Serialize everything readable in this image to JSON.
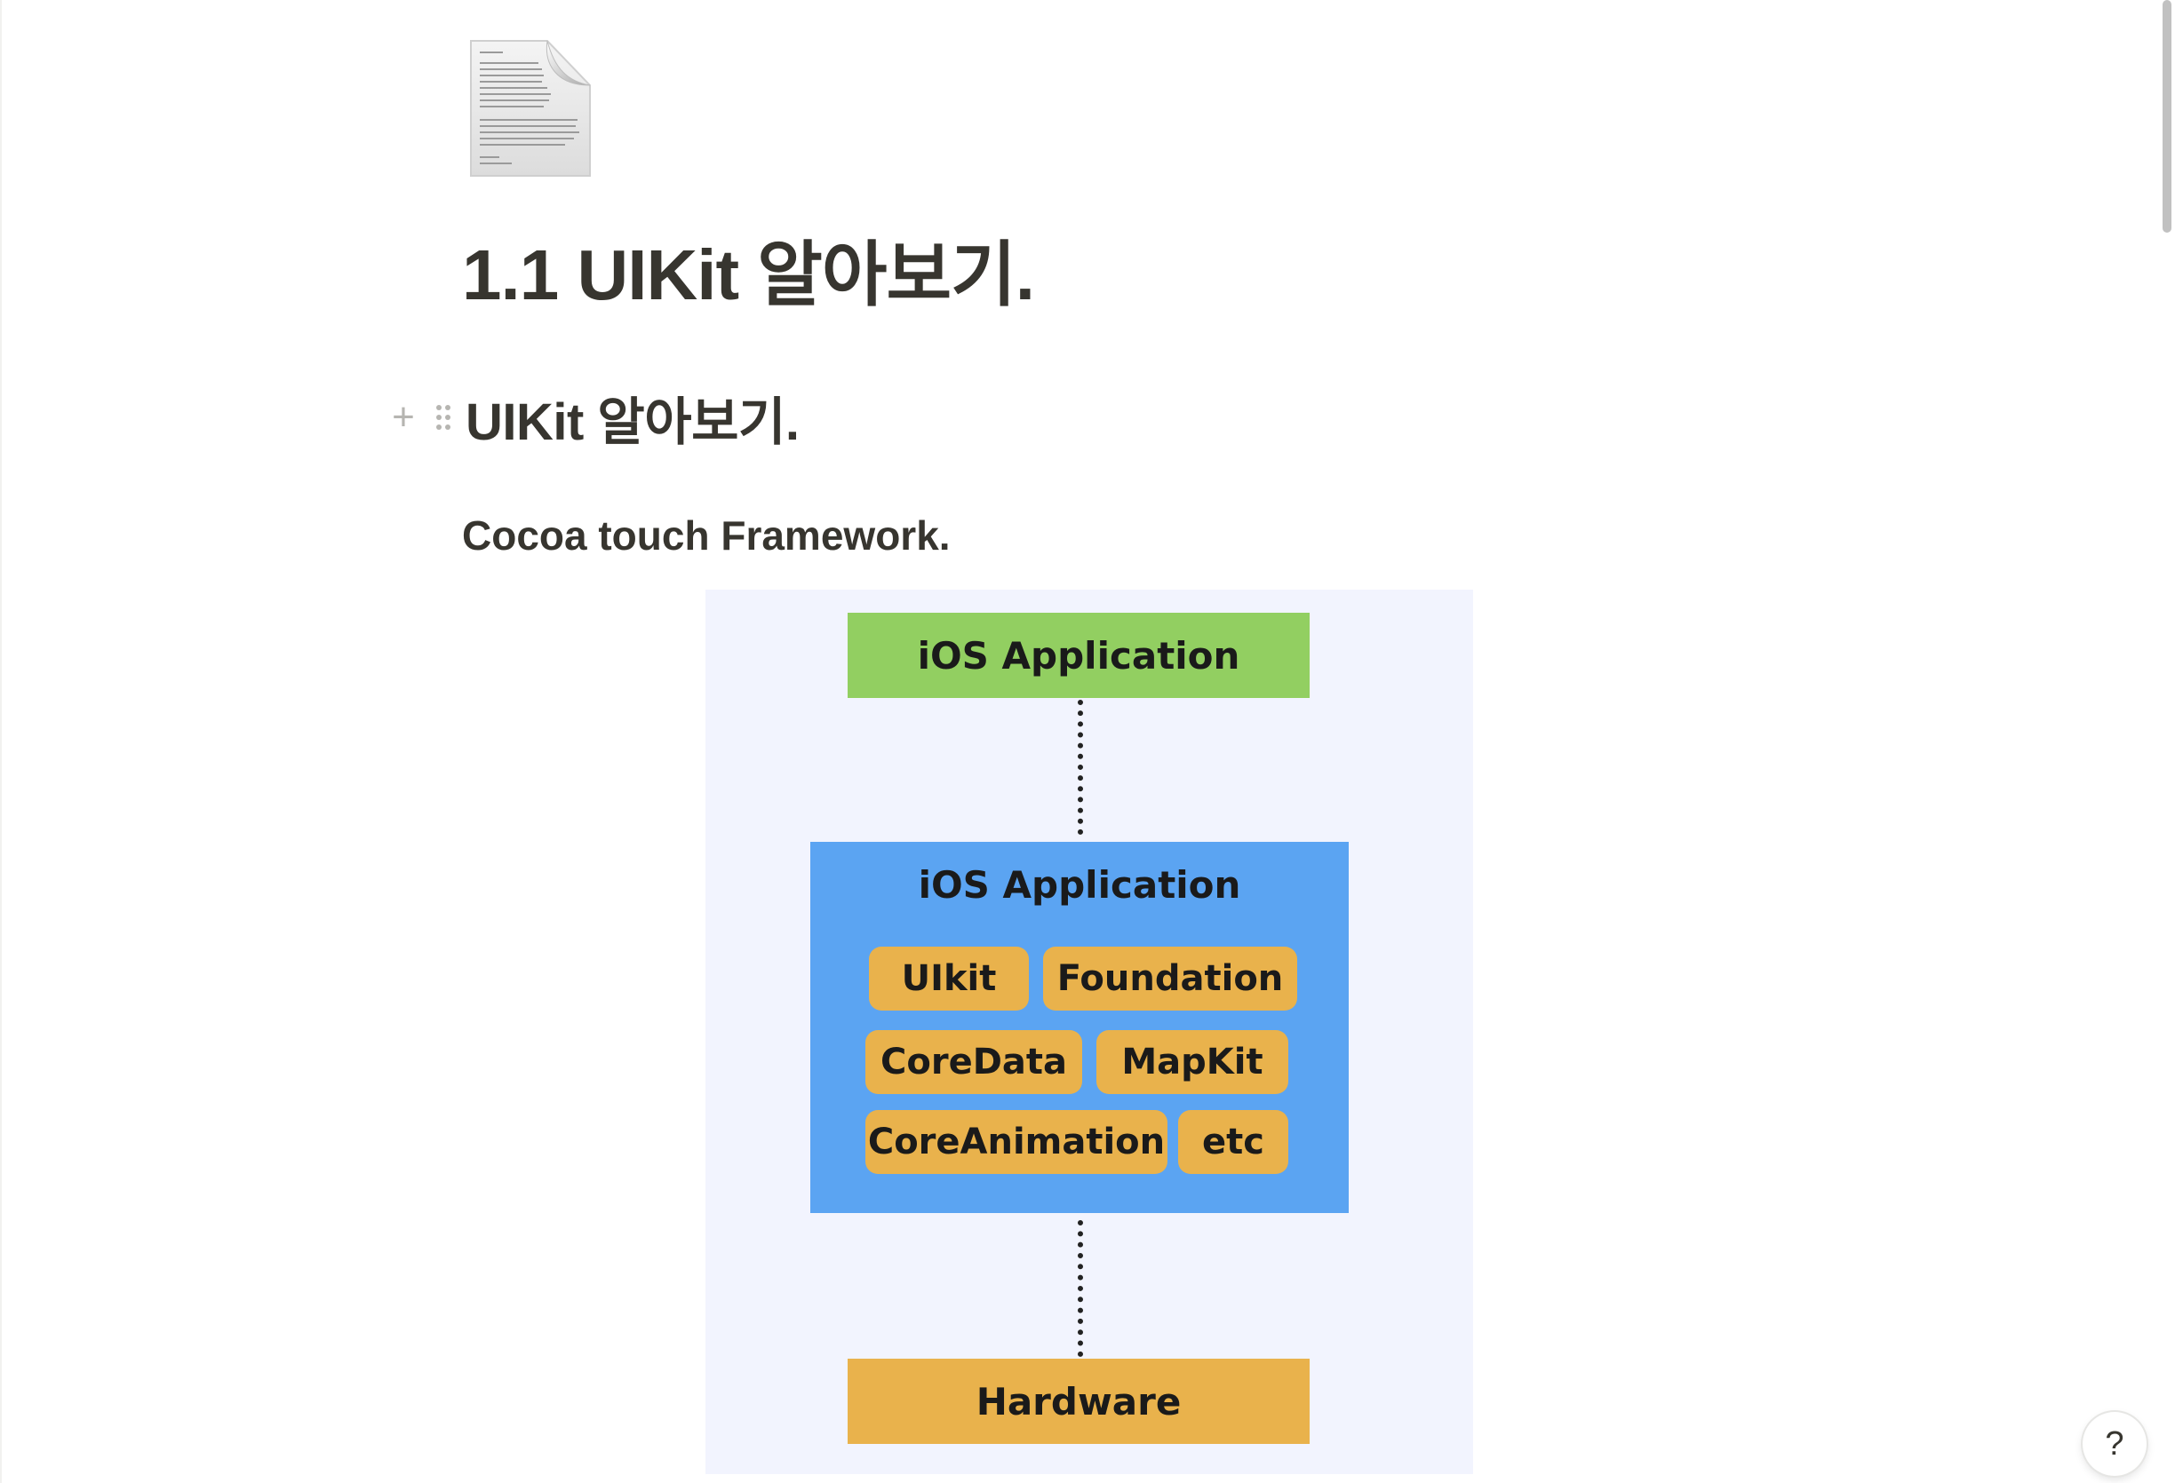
{
  "page": {
    "icon": "document-page-icon",
    "title": "1.1 UIKit 알아보기."
  },
  "blocks": {
    "heading1": "UIKit 알아보기.",
    "heading3": "Cocoa touch Framework.",
    "plus_glyph": "+",
    "drag_icon": "drag-handle-icon"
  },
  "diagram": {
    "top_layer": "iOS Application",
    "middle_layer": "iOS Application",
    "frameworks": [
      "UIkit",
      "Foundation",
      "CoreData",
      "MapKit",
      "CoreAnimation",
      "etc"
    ],
    "bottom_layer": "Hardware",
    "colors": {
      "background": "#f2f4fe",
      "top": "#92cf61",
      "middle": "#5ba4f2",
      "framework": "#e9b24c",
      "bottom": "#e9b24c"
    }
  },
  "help": {
    "label": "?"
  }
}
